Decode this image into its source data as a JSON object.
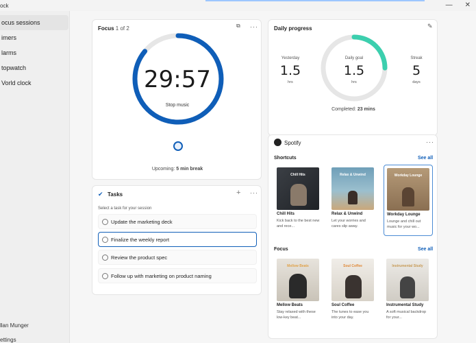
{
  "app": {
    "title": "ock"
  },
  "window": {
    "minimize": "—",
    "close": "✕"
  },
  "sidebar": {
    "items": [
      {
        "label": "ocus sessions",
        "active": true
      },
      {
        "label": "imers",
        "active": false
      },
      {
        "label": "larms",
        "active": false
      },
      {
        "label": "topwatch",
        "active": false
      },
      {
        "label": "Vorld clock",
        "active": false
      }
    ],
    "user": "llan Munger",
    "settings": "ettings"
  },
  "focus": {
    "title": "Focus",
    "counter": "1 of 2",
    "time": "29:57",
    "stop_label": "Stop music",
    "progress": 0.86,
    "upcoming_prefix": "Upcoming: ",
    "upcoming_value": "5 min break"
  },
  "tasks": {
    "title": "Tasks",
    "add": "+",
    "subtitle": "Select a task for your session",
    "items": [
      {
        "label": "Update the marketing deck"
      },
      {
        "label": "Finalize the weekly report"
      },
      {
        "label": "Review the product spec"
      },
      {
        "label": "Follow up with marketing on product naming"
      }
    ]
  },
  "daily": {
    "title": "Daily progress",
    "yesterday": {
      "label": "Yesterday",
      "value": "1.5",
      "unit": "hrs"
    },
    "goal": {
      "label": "Daily goal",
      "value": "1.5",
      "unit": "hrs"
    },
    "streak": {
      "label": "Streak",
      "value": "5",
      "unit": "days"
    },
    "goal_progress": 0.25,
    "completed_prefix": "Completed: ",
    "completed_value": "23 mins"
  },
  "spotify": {
    "title": "Spotify",
    "shortcuts": {
      "label": "Shortcuts",
      "see_all": "See all",
      "items": [
        {
          "name": "Chill Hits",
          "desc": "Kick back to the best new and rece...",
          "art": "Chill Hits"
        },
        {
          "name": "Relax & Unwind",
          "desc": "Let your worries and cares slip away.",
          "art": "Relax & Unwind"
        },
        {
          "name": "Workday Lounge",
          "desc": "Lounge and chill out music for your wo...",
          "art": "Workday Lounge"
        }
      ]
    },
    "focus": {
      "label": "Focus",
      "see_all": "See all",
      "items": [
        {
          "name": "Mellow  Beats",
          "desc": "Stay relaxed with these low-key beat...",
          "art": "Mellow Beats"
        },
        {
          "name": "Soul Coffee",
          "desc": "The tunes to ease you into your day.",
          "art": "Soul Coffee"
        },
        {
          "name": "Instrumental Study",
          "desc": "A soft musical backdrop for your...",
          "art": "Instrumental Study"
        }
      ]
    }
  },
  "colors": {
    "accent": "#0f5eb8",
    "goal": "#3ccfae",
    "track": "#e6e6e6"
  }
}
